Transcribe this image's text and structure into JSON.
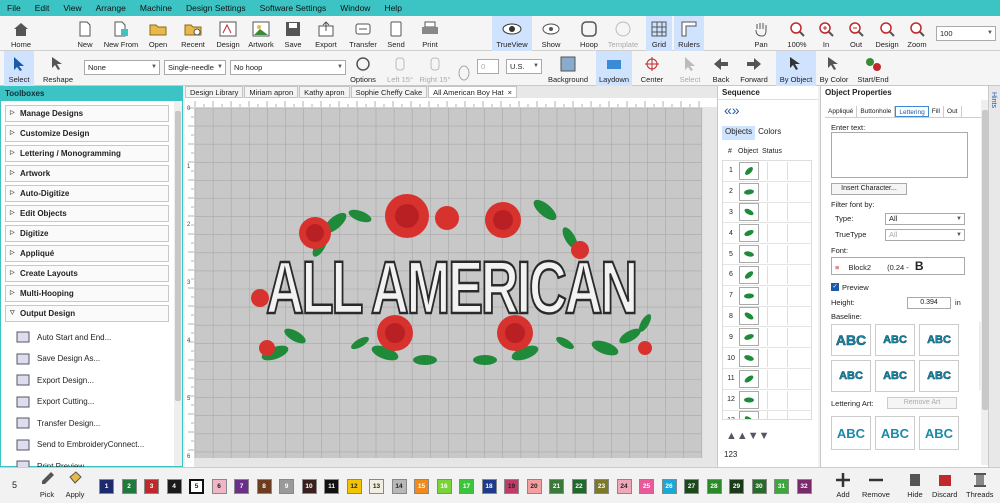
{
  "menu": [
    "File",
    "Edit",
    "View",
    "Arrange",
    "Machine",
    "Design Settings",
    "Software Settings",
    "Window",
    "Help"
  ],
  "toolbar1": {
    "home": "Home",
    "new": "New",
    "new_from": "New From",
    "open": "Open",
    "recent": "Recent",
    "design": "Design",
    "artwork": "Artwork",
    "save": "Save",
    "export": "Export",
    "transfer": "Transfer",
    "send": "Send",
    "print": "Print",
    "trueview": "TrueView",
    "show": "Show",
    "hoop": "Hoop",
    "template": "Template",
    "grid": "Grid",
    "rulers": "Rulers",
    "pan": "Pan",
    "zoom100": "100%",
    "in": "In",
    "out": "Out",
    "design_zoom": "Design",
    "zoom": "Zoom",
    "zoom_value": "100"
  },
  "toolbar2": {
    "select": "Select",
    "reshape": "Reshape",
    "fill_select": "None",
    "needle_select": "Single-needle",
    "hoop_select": "No hoop",
    "options": "Options",
    "left15": "Left 15°",
    "right15": "Right 15°",
    "num_value": "0",
    "units": "U.S.",
    "background": "Background",
    "laydown": "Laydown",
    "center": "Center",
    "select2": "Select",
    "back": "Back",
    "forward": "Forward",
    "by_object": "By Object",
    "by_color": "By Color",
    "start_end": "Start/End"
  },
  "toolboxes": {
    "title": "Toolboxes",
    "items": [
      "Manage Designs",
      "Customize Design",
      "Lettering / Monogramming",
      "Artwork",
      "Auto-Digitize",
      "Edit Objects",
      "Digitize",
      "Appliqué",
      "Create Layouts",
      "Multi-Hooping",
      "Output Design"
    ],
    "output_items": [
      "Auto Start and End...",
      "Save Design As...",
      "Export Design...",
      "Export Cutting...",
      "Transfer Design...",
      "Send to EmbroideryConnect...",
      "Print Preview..."
    ]
  },
  "doc_tabs": [
    "Design Library",
    "Miriam apron",
    "Kathy apron",
    "Sophie Cheffy Cake",
    "All American Boy Hat"
  ],
  "design_text": "ALL AMERICAN",
  "ruler_marks": [
    "0",
    "1",
    "2",
    "3",
    "4",
    "5",
    "6"
  ],
  "sequence": {
    "title": "Sequence",
    "tab_objects": "Objects",
    "tab_colors": "Colors",
    "col_num": "#",
    "col_object": "Object",
    "col_status": "Status",
    "rows": [
      "1",
      "2",
      "3",
      "4",
      "5",
      "6",
      "7",
      "8",
      "9",
      "10",
      "11",
      "12",
      "13"
    ],
    "footer_num": "123"
  },
  "properties": {
    "title": "Object Properties",
    "tabs": [
      "Appliqué",
      "Buttonhole",
      "Lettering",
      "Fill",
      "Out"
    ],
    "enter_text": "Enter text:",
    "insert_char": "Insert Character...",
    "filter_font": "Filter font by:",
    "type_label": "Type:",
    "type_value": "All",
    "truetype_label": "TrueType",
    "truetype_value": "All",
    "font_label": "Font:",
    "font_value": "Block2",
    "font_range": "(0.24 -",
    "preview": "Preview",
    "height_label": "Height:",
    "height_value": "0.394",
    "height_unit": "in",
    "baseline_label": "Baseline:",
    "lettering_art": "Lettering Art:",
    "remove_art": "Remove Art",
    "abc": "ABC"
  },
  "hints": "Hints",
  "bottom": {
    "current": "5",
    "pick": "Pick",
    "apply": "Apply",
    "swatches": [
      "1",
      "2",
      "3",
      "4",
      "5",
      "6",
      "7",
      "8",
      "9",
      "10",
      "11",
      "12",
      "13",
      "14",
      "15",
      "16",
      "17",
      "18",
      "19",
      "20",
      "21",
      "22",
      "23",
      "24",
      "25",
      "26",
      "27",
      "28",
      "29",
      "30",
      "31",
      "32"
    ],
    "colors": [
      "#1e2a6e",
      "#1c7a3a",
      "#c0282c",
      "#1a1a1a",
      "#ffffff",
      "#f0b6c8",
      "#6a2f8a",
      "#6b3c1f",
      "#9a9a9a",
      "#3a1f1f",
      "#111111",
      "#f5c400",
      "#f0eee0",
      "#b8b8b8",
      "#f28a1a",
      "#7ad33a",
      "#3cc43c",
      "#1e3a8a",
      "#c03a6a",
      "#f4a0a0",
      "#3a7a3a",
      "#1f6a2a",
      "#7a7a2a",
      "#f0a8b8",
      "#e85a9a",
      "#1aa8d8",
      "#1a4a1a",
      "#2a8a2a",
      "#1a3a1a",
      "#2a6a2a",
      "#3aa83a",
      "#7a2a6a"
    ],
    "add": "Add",
    "remove": "Remove",
    "hide": "Hide",
    "discard": "Discard",
    "threads": "Threads"
  }
}
